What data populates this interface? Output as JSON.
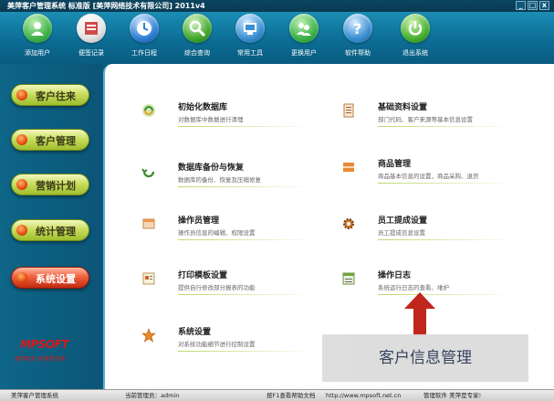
{
  "window": {
    "title": "美萍客户管理系统 标准版 [美萍网络技术有限公司] 2011v4",
    "controls": [
      "_",
      "□",
      "x"
    ]
  },
  "toolbar": [
    {
      "label": "添加用户",
      "icon": "add-user-icon",
      "color": "#3db24a"
    },
    {
      "label": "便签记录",
      "icon": "memo-icon",
      "color": "#d04a4a"
    },
    {
      "label": "工作日程",
      "icon": "schedule-icon",
      "color": "#2f7fd6"
    },
    {
      "label": "综合查询",
      "icon": "search-icon",
      "color": "#43a62d"
    },
    {
      "label": "常用工具",
      "icon": "tools-icon",
      "color": "#3a8fd2"
    },
    {
      "label": "更换用户",
      "icon": "switch-user-icon",
      "color": "#3db24a"
    },
    {
      "label": "软件帮助",
      "icon": "help-icon",
      "color": "#3a8fd2"
    },
    {
      "label": "退出系统",
      "icon": "power-icon",
      "color": "#48b12e"
    }
  ],
  "sidebar": [
    {
      "label": "客户往来",
      "active": false
    },
    {
      "label": "客户管理",
      "active": false
    },
    {
      "label": "营销计划",
      "active": false
    },
    {
      "label": "统计管理",
      "active": false
    },
    {
      "label": "系统设置",
      "active": true
    }
  ],
  "logo": {
    "text": "MPSOFT",
    "subtitle": "美萍软件 美萍是专家"
  },
  "items": [
    {
      "title": "初始化数据库",
      "desc": "对数据库中数据进行清理",
      "icon": "refresh-database-icon"
    },
    {
      "title": "基础资料设置",
      "desc": "部门代码、客户来源等基本信息设置",
      "icon": "document-icon"
    },
    {
      "title": "数据库备份与恢复",
      "desc": "数据库的备份、恢复及压缩修复",
      "icon": "backup-restore-icon"
    },
    {
      "title": "商品管理",
      "desc": "商品基本信息的设置，商品采购、退货",
      "icon": "goods-icon"
    },
    {
      "title": "操作员管理",
      "desc": "操作员信息的编辑、权限设置",
      "icon": "operator-icon"
    },
    {
      "title": "员工提成设置",
      "desc": "员工提成信息设置",
      "icon": "gear-icon"
    },
    {
      "title": "打印模板设置",
      "desc": "提供自行修改部分报表的功能",
      "icon": "print-template-icon"
    },
    {
      "title": "操作日志",
      "desc": "系统运行日志的查看、维护",
      "icon": "log-icon"
    },
    {
      "title": "系统设置",
      "desc": "对系统功能细节进行控制设置",
      "icon": "star-icon"
    }
  ],
  "overlay": {
    "text": "客户信息管理"
  },
  "status": {
    "app": "美萍客户管理系统",
    "operator": "当前管理员：admin",
    "help": "按F1查看帮助文档",
    "url": "http://www.mpsoft.net.cn",
    "slogan": "管理软件 美萍是专家!"
  }
}
